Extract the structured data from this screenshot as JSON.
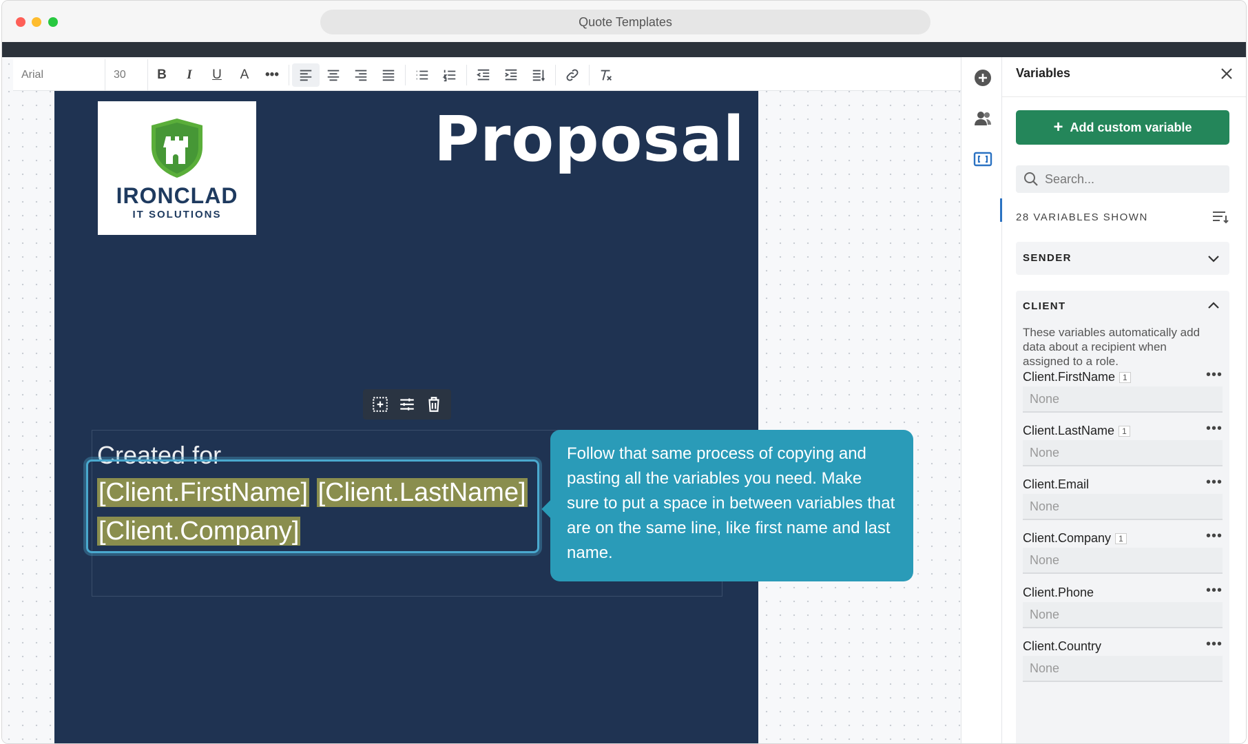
{
  "window": {
    "title": "Quote Templates"
  },
  "toolbar": {
    "font_family": "Arial",
    "font_size": "30"
  },
  "page": {
    "logo_name": "IRONCLAD",
    "logo_sub": "IT SOLUTIONS",
    "heading": "Proposal",
    "created_for": "Created for",
    "var_first": "[Client.FirstName]",
    "var_last": "[Client.LastName]",
    "var_company": "[Client.Company]"
  },
  "tooltip": {
    "text": "Follow that same process of copying and pasting all the variables you need. Make sure to put a space in between variables that are on the same line, like first name and last name."
  },
  "panel": {
    "title": "Variables",
    "add_button": "Add custom variable",
    "search_placeholder": "Search...",
    "shown_label": "28 VARIABLES SHOWN",
    "sections": {
      "sender": "SENDER",
      "client": "CLIENT",
      "client_desc": "These variables automatically add data about a recipient when assigned to a role."
    },
    "variables": [
      {
        "name": "Client.FirstName",
        "badge": "1",
        "value": "None"
      },
      {
        "name": "Client.LastName",
        "badge": "1",
        "value": "None"
      },
      {
        "name": "Client.Email",
        "badge": "",
        "value": "None"
      },
      {
        "name": "Client.Company",
        "badge": "1",
        "value": "None"
      },
      {
        "name": "Client.Phone",
        "badge": "",
        "value": "None"
      },
      {
        "name": "Client.Country",
        "badge": "",
        "value": "None"
      }
    ]
  },
  "colors": {
    "page_bg": "#1f3352",
    "accent_green": "#24865a",
    "tooltip_bg": "#2a9bb8",
    "var_highlight": "#8a8e4e"
  }
}
